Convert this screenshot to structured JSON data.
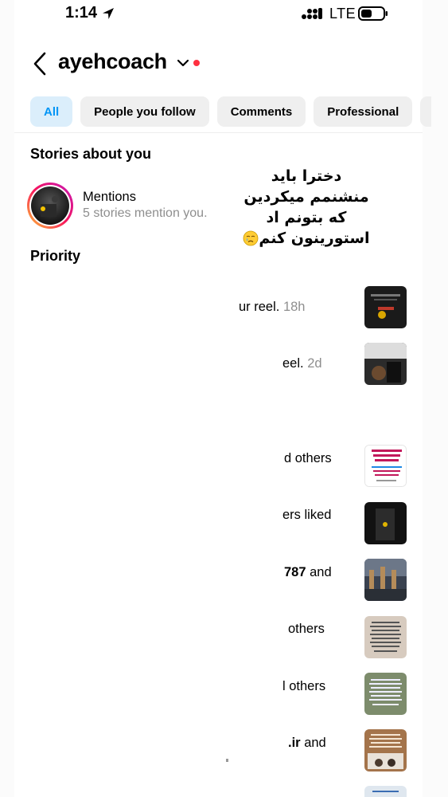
{
  "status_bar": {
    "time": "1:14",
    "network": "LTE",
    "location_icon": "location-arrow-icon",
    "signal_icon": "cellular-signal-icon",
    "battery_icon": "battery-icon"
  },
  "header": {
    "account_name": "ayehcoach",
    "back_icon": "chevron-left-icon",
    "switch_icon": "chevron-down-icon",
    "notification_color": "#ff3040"
  },
  "tabs": [
    {
      "label": "All",
      "active": true
    },
    {
      "label": "People you follow",
      "active": false
    },
    {
      "label": "Comments",
      "active": false
    },
    {
      "label": "Professional",
      "active": false
    }
  ],
  "accent_color": "#0095f6",
  "sections": {
    "stories_title": "Stories about you",
    "priority_title": "Priority"
  },
  "mentions": {
    "title": "Mentions",
    "subtitle": "5 stories mention you."
  },
  "overlay": {
    "lines": [
      "دخترا باید",
      "منشنمم میکردین",
      "که بتونم اد",
      "استورینون کنم"
    ],
    "emoji_icon": "crying-face-icon"
  },
  "activity": [
    {
      "text": "ur reel.",
      "time": "18h"
    },
    {
      "text": "eel.",
      "time": "2d"
    },
    {
      "text": "d others",
      "time": ""
    },
    {
      "text": "ers liked",
      "time": ""
    },
    {
      "text": "787",
      "suffix": "and",
      "time": ""
    },
    {
      "text": "others",
      "time": ""
    },
    {
      "text": "l others",
      "time": ""
    },
    {
      "text": ".ir",
      "suffix": "and",
      "time": ""
    }
  ]
}
